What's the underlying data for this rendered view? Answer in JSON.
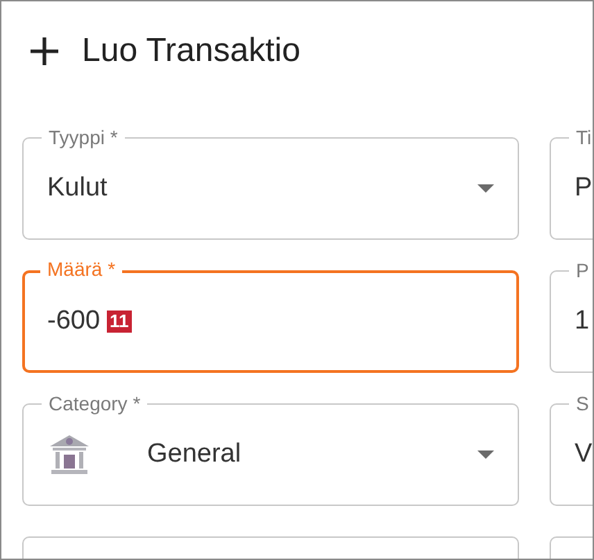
{
  "dialog": {
    "title": "Luo Transaktio"
  },
  "rows": [
    {
      "left": {
        "kind": "select",
        "label": "Tyyppi *",
        "value": "Kulut",
        "focused": false
      },
      "right": {
        "label": "Ti",
        "value": "P",
        "focused": false
      }
    },
    {
      "left": {
        "kind": "input",
        "label": "Määrä *",
        "value": "-600",
        "badge": "11",
        "focused": true
      },
      "right": {
        "label": "P",
        "value": "1",
        "focused": false
      }
    },
    {
      "left": {
        "kind": "icon-select",
        "label": "Category *",
        "value": "General",
        "focused": false
      },
      "right": {
        "label": "S",
        "value": "V",
        "focused": false
      }
    }
  ]
}
